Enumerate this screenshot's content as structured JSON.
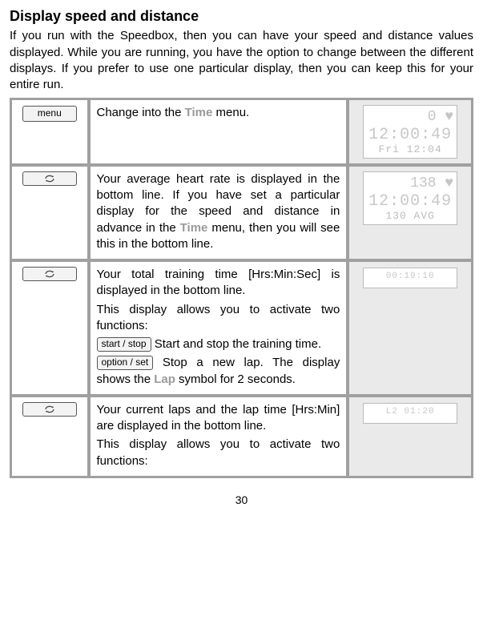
{
  "title": "Display speed and distance",
  "intro": "If you run with the Speedbox, then you can have your speed and distance values displayed. While you are running, you have the option to change between the different displays. If you prefer to use one particular display, then you can keep this for your entire run.",
  "rows": [
    {
      "button_type": "menu",
      "button_label": "menu",
      "desc": [
        {
          "text_before": "Change into the ",
          "gray": "Time",
          "text_after": " menu."
        }
      ],
      "screen": {
        "lines": [
          "0  ♥",
          "12:00:49",
          "Fri 12:04"
        ],
        "style": "full"
      }
    },
    {
      "button_type": "cycle",
      "desc": [
        {
          "text_before": "Your average heart rate is displayed in the bottom line. If you have set a particular display for the speed and distance in advance in the ",
          "gray": "Time",
          "text_after": " menu, then you will see this in the bottom line."
        }
      ],
      "screen": {
        "lines": [
          "138  ♥",
          "12:00:49",
          "130  AVG"
        ],
        "style": "full"
      }
    },
    {
      "button_type": "cycle",
      "desc": [
        {
          "text_before": "Your total training time [Hrs:Min:Sec] is displayed in the bottom line."
        },
        {
          "text_before": "This display allows you to activate two functions:"
        },
        {
          "inline_btn": "start / stop",
          "text_after": " Start and stop the training time."
        },
        {
          "inline_btn": "option / set",
          "text_after": " Stop a new lap. The display shows the ",
          "gray": "Lap",
          "tail": " symbol for 2 seconds."
        }
      ],
      "screen": {
        "lines": [
          "00:19:10"
        ],
        "style": "short"
      }
    },
    {
      "button_type": "cycle",
      "desc": [
        {
          "text_before": "Your current laps and the lap time [Hrs:Min] are displayed in the bottom line."
        },
        {
          "text_before": "This display allows you to activate two functions:"
        }
      ],
      "screen": {
        "lines": [
          "L2 01:20"
        ],
        "style": "short"
      }
    }
  ],
  "page": "30"
}
